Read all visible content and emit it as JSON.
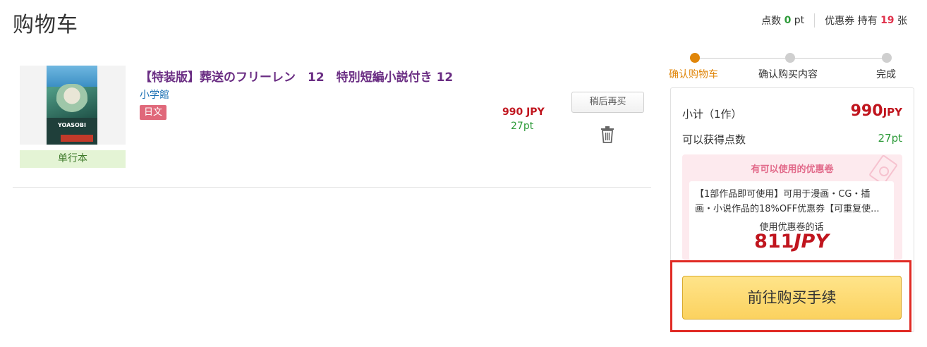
{
  "page": {
    "title": "购物车"
  },
  "header": {
    "points_label": "点数",
    "points_value": "0",
    "points_unit": "pt",
    "coupons_label": "优惠券 持有",
    "coupons_value": "19",
    "coupons_unit": "张"
  },
  "cart": {
    "items": [
      {
        "title": "【特装版】葬送のフリーレン　12　特別短編小説付き 12",
        "publisher": "小学館",
        "language": "日文",
        "format": "单行本",
        "price": "990 JPY",
        "points": "27pt",
        "later_button": "稍后再买",
        "cover_text": "YOASOBI",
        "icons": {
          "delete": "trash-icon"
        }
      }
    ]
  },
  "steps": [
    {
      "label": "确认购物车",
      "active": true
    },
    {
      "label": "确认购买内容",
      "active": false
    },
    {
      "label": "完成",
      "active": false
    }
  ],
  "summary": {
    "subtotal_label": "小计（1作）",
    "subtotal_value": "990",
    "subtotal_unit": "JPY",
    "points_label": "可以获得点数",
    "points_value": "27pt",
    "coupon": {
      "header": "有可以使用的优惠卷",
      "description": "【1部作品即可使用】可用于漫画・CG・插画・小说作品的18%OFF优惠券【可重复使...",
      "use_label": "使用优惠卷的话",
      "price_value": "811",
      "price_unit": "JPY"
    },
    "checkout_button": "前往购买手续"
  },
  "colors": {
    "accent_orange": "#e0860a",
    "price_red": "#c0151e",
    "points_green": "#2e9b3a",
    "title_purple": "#6a2d83",
    "highlight_frame": "#e02a24",
    "checkout_yellow": "#fbd25f"
  }
}
